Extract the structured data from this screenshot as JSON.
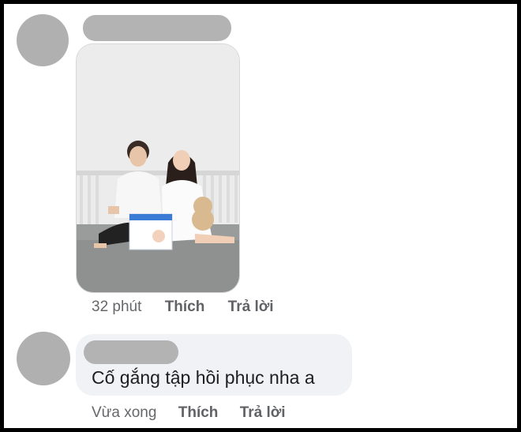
{
  "comments": [
    {
      "time": "32 phút",
      "like_label": "Thích",
      "reply_label": "Trả lời"
    },
    {
      "text": "Cố gắng tập hồi phục nha a",
      "time": "Vừa xong",
      "like_label": "Thích",
      "reply_label": "Trả lời"
    }
  ],
  "colors": {
    "avatar_placeholder": "#b0b0b0",
    "bubble_bg": "#f0f2f5",
    "meta_text": "#65676b"
  }
}
